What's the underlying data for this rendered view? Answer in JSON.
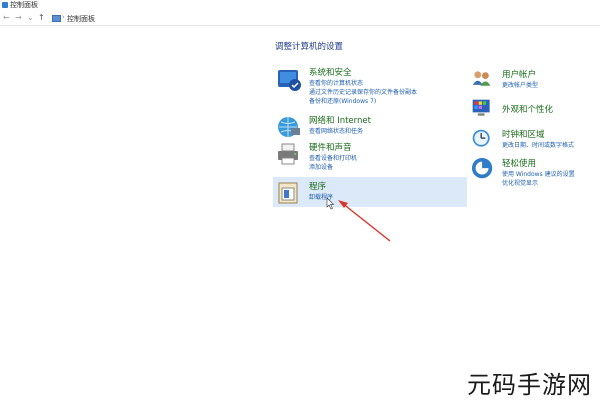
{
  "window": {
    "title": "控制面板"
  },
  "navbar": {
    "back": "←",
    "forward": "→",
    "recent": "⌄",
    "up": "↑",
    "separator": "›",
    "breadcrumb": "控制面板"
  },
  "heading": "调整计算机的设置",
  "categories_left": [
    {
      "title": "系统和安全",
      "links": [
        "查看你的计算机状态",
        "通过文件历史记录保存你的文件备份副本",
        "备份和还原(Windows 7)"
      ],
      "icon": "shield-icon"
    },
    {
      "title": "网络和 Internet",
      "links": [
        "查看网络状态和任务"
      ],
      "icon": "globe-icon"
    },
    {
      "title": "硬件和声音",
      "links": [
        "查看设备和打印机",
        "添加设备"
      ],
      "icon": "printer-icon"
    },
    {
      "title": "程序",
      "links": [
        "卸载程序"
      ],
      "icon": "programs-icon"
    }
  ],
  "categories_right": [
    {
      "title": "用户帐户",
      "links": [
        "更改帐户类型"
      ],
      "icon": "users-icon"
    },
    {
      "title": "外观和个性化",
      "links": [],
      "icon": "palette-icon"
    },
    {
      "title": "时钟和区域",
      "links": [
        "更改日期、时间或数字格式"
      ],
      "icon": "clock-icon"
    },
    {
      "title": "轻松使用",
      "links": [
        "使用 Windows 建议的设置",
        "优化视觉显示"
      ],
      "icon": "accessibility-icon"
    }
  ],
  "watermark": "元码手游网",
  "colors": {
    "category_title": "#1a6b1a",
    "link": "#2060b0",
    "heading": "#1e3a8a",
    "highlight": "#dbe9f8",
    "arrow": "#d9362b"
  }
}
